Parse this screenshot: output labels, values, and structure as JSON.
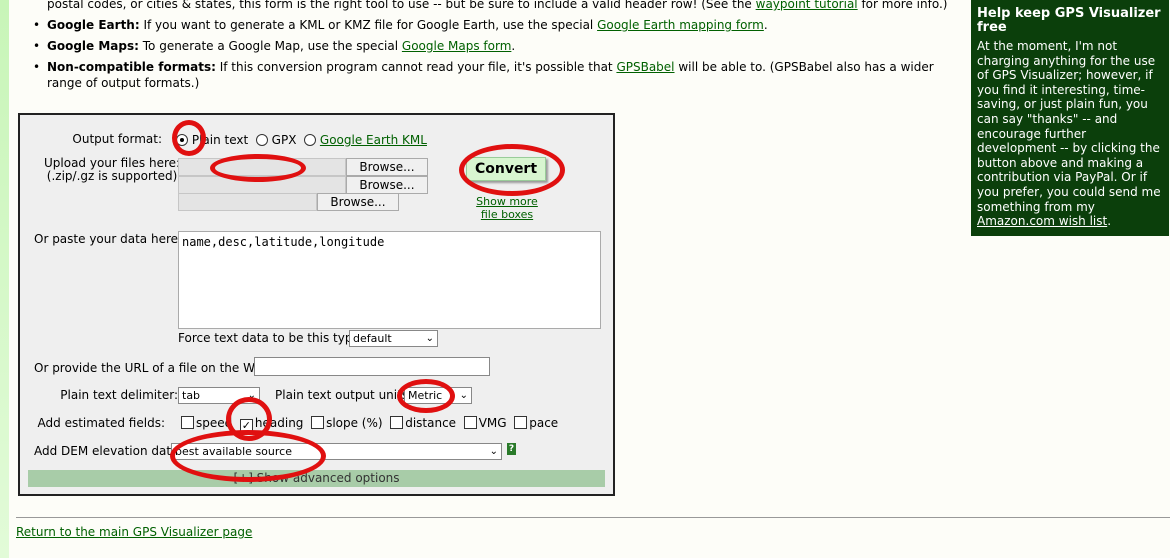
{
  "intro": {
    "line1_text": "postal codes, or cities & states, this form is the right tool to use -- but be sure to include a valid header row! (See the ",
    "line1_link": "waypoint tutorial",
    "line1_end": " for more info.)",
    "bullets": [
      {
        "bold": "Google Earth:",
        "text": " If you want to generate a KML or KMZ file for Google Earth, use the special ",
        "link": "Google Earth mapping form",
        "end": "."
      },
      {
        "bold": "Google Maps:",
        "text": " To generate a Google Map, use the special ",
        "link": "Google Maps form",
        "end": "."
      },
      {
        "bold": "Non-compatible formats:",
        "text": " If this conversion program cannot read your file, it's possible that ",
        "link": "GPSBabel",
        "end": " will be able to. (GPSBabel also has a wider range of output formats.)"
      }
    ]
  },
  "form": {
    "output_format_label": "Output format:",
    "formats": [
      "Plain text",
      "GPX",
      "Google Earth KML"
    ],
    "selected_format": "Plain text",
    "upload_label": "Upload your files here:",
    "upload_hint": "(.zip/.gz is supported)",
    "browse_label": "Browse...",
    "convert_label": "Convert",
    "show_more_label": "Show more file boxes",
    "paste_label": "Or paste your data here:",
    "paste_value": "name,desc,latitude,longitude",
    "force_type_label": "Force text data to be this type:",
    "force_type_value": "default",
    "url_label": "Or provide the URL of a file on the Web:",
    "url_value": "",
    "delimiter_label": "Plain text delimiter:",
    "delimiter_value": "tab",
    "units_label": "Plain text output units:",
    "units_value": "Metric",
    "estimated_label": "Add estimated fields:",
    "fields": [
      {
        "label": "speed",
        "checked": false
      },
      {
        "label": "heading",
        "checked": true
      },
      {
        "label": "slope (%)",
        "checked": false
      },
      {
        "label": "distance",
        "checked": false
      },
      {
        "label": "VMG",
        "checked": false
      },
      {
        "label": "pace",
        "checked": false
      }
    ],
    "dem_label": "Add DEM elevation data:",
    "dem_value": "best available source",
    "help_label": "?",
    "advanced_label": "[+] Show advanced options"
  },
  "sidebar": {
    "title": "Help keep GPS Visualizer free",
    "body": "At the moment, I'm not charging anything for the use of GPS Visualizer; however, if you find it interesting, time-saving, or just plain fun, you can say \"thanks\" -- and encourage further development -- by clicking the button above and making a contribution via PayPal. Or if you prefer, you could send me something from my ",
    "link": "Amazon.com wish list",
    "end": "."
  },
  "footer": {
    "return_link": "Return to the main GPS Visualizer page"
  },
  "colors": {
    "link": "#006000",
    "sidebar_bg": "#0b3f0b",
    "annotation": "#e01010",
    "advanced_bar": "#a8cca8"
  }
}
